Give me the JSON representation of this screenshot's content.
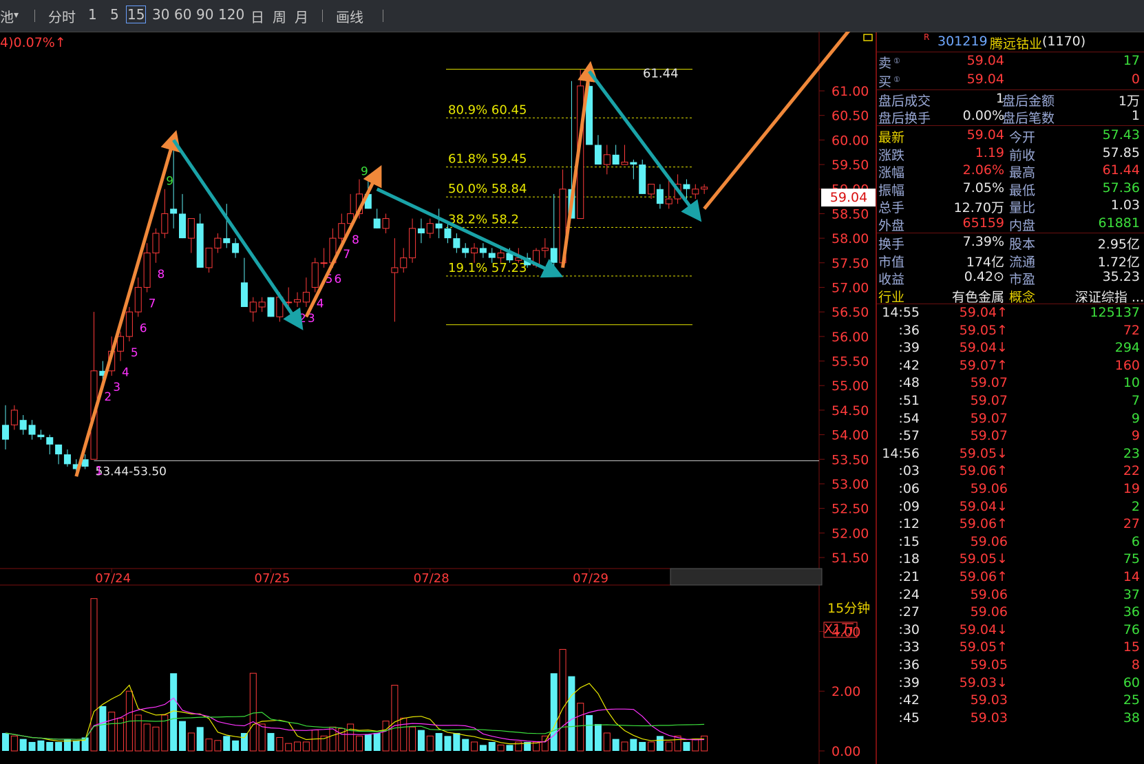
{
  "toolbar": {
    "left_fragment": "池",
    "periods": [
      "分时",
      "1",
      "5",
      "15",
      "30",
      "60",
      "90",
      "120",
      "日",
      "周",
      "月"
    ],
    "selected_period": "15",
    "draw_label": "画线"
  },
  "header": {
    "change_text": "4)0.07%↑"
  },
  "chart_data": [
    {
      "type": "candlestick",
      "price_ylim": [
        51.5,
        61.5
      ],
      "price_ticks": [
        "61.00",
        "60.50",
        "60.00",
        "59.50",
        "59.00",
        "58.50",
        "58.00",
        "57.50",
        "57.00",
        "56.50",
        "56.00",
        "55.50",
        "55.00",
        "54.50",
        "54.00",
        "53.50",
        "53.00",
        "52.50",
        "52.00",
        "51.50"
      ],
      "date_labels": [
        "07/24",
        "07/25",
        "07/28",
        "07/29"
      ],
      "period_label": "15分钟",
      "candles": [
        [
          54.2,
          54.6,
          53.7,
          53.9
        ],
        [
          54.2,
          54.6,
          54.1,
          54.5
        ],
        [
          54.3,
          54.4,
          54.0,
          54.1
        ],
        [
          54.2,
          54.3,
          53.9,
          54.0
        ],
        [
          54.0,
          54.1,
          53.9,
          53.95
        ],
        [
          53.95,
          54.0,
          53.6,
          53.8
        ],
        [
          53.8,
          53.8,
          53.4,
          53.6
        ],
        [
          53.6,
          53.7,
          53.35,
          53.4
        ],
        [
          53.4,
          53.5,
          53.2,
          53.3
        ],
        [
          53.5,
          53.6,
          53.3,
          53.35
        ],
        [
          53.5,
          56.5,
          53.5,
          55.3
        ],
        [
          55.3,
          55.5,
          55.0,
          55.2
        ],
        [
          55.3,
          56.0,
          55.2,
          55.7
        ],
        [
          55.7,
          56.1,
          55.5,
          56.0
        ],
        [
          56.0,
          56.6,
          55.9,
          56.5
        ],
        [
          56.5,
          57.2,
          56.4,
          57.0
        ],
        [
          57.0,
          57.9,
          56.9,
          57.7
        ],
        [
          57.7,
          58.2,
          57.5,
          58.1
        ],
        [
          58.1,
          59.0,
          58.0,
          58.5
        ],
        [
          58.6,
          60.1,
          58.2,
          58.5
        ],
        [
          58.5,
          58.9,
          58.0,
          58.0
        ],
        [
          58.0,
          58.4,
          57.7,
          58.4
        ],
        [
          58.3,
          58.5,
          57.4,
          57.4
        ],
        [
          57.4,
          57.8,
          57.3,
          57.8
        ],
        [
          57.8,
          58.1,
          57.7,
          58.0
        ],
        [
          58.0,
          58.7,
          57.8,
          57.9
        ],
        [
          57.9,
          58.0,
          57.6,
          57.7
        ],
        [
          57.1,
          57.6,
          56.9,
          56.6
        ],
        [
          56.5,
          56.8,
          56.3,
          56.7
        ],
        [
          56.6,
          56.8,
          56.5,
          56.7
        ],
        [
          56.8,
          56.8,
          56.4,
          56.4
        ],
        [
          56.4,
          56.9,
          56.3,
          56.8
        ],
        [
          56.7,
          57.0,
          56.6,
          56.7
        ],
        [
          56.7,
          56.9,
          56.6,
          56.75
        ],
        [
          56.7,
          57.2,
          56.6,
          56.9
        ],
        [
          57.0,
          57.6,
          56.9,
          57.5
        ],
        [
          57.5,
          57.8,
          57.4,
          57.5
        ],
        [
          57.5,
          58.2,
          57.4,
          58.0
        ],
        [
          58.0,
          58.5,
          57.9,
          58.3
        ],
        [
          58.3,
          58.9,
          58.2,
          58.5
        ],
        [
          58.5,
          59.2,
          58.4,
          58.9
        ],
        [
          58.9,
          59.2,
          58.6,
          58.6
        ],
        [
          58.4,
          58.6,
          58.2,
          58.2
        ],
        [
          58.2,
          58.5,
          58.1,
          58.4
        ],
        [
          57.3,
          58.0,
          56.3,
          57.4
        ],
        [
          57.4,
          57.8,
          57.3,
          57.6
        ],
        [
          57.6,
          58.4,
          57.5,
          58.2
        ],
        [
          58.2,
          58.4,
          57.9,
          58.1
        ],
        [
          58.1,
          58.4,
          58.0,
          58.3
        ],
        [
          58.3,
          58.6,
          58.0,
          58.2
        ],
        [
          58.2,
          58.3,
          57.9,
          58.0
        ],
        [
          58.0,
          58.1,
          57.7,
          57.8
        ],
        [
          57.8,
          57.9,
          57.6,
          57.7
        ],
        [
          57.7,
          57.9,
          57.5,
          57.8
        ],
        [
          57.8,
          57.9,
          57.6,
          57.7
        ],
        [
          57.7,
          57.8,
          57.5,
          57.6
        ],
        [
          57.6,
          57.8,
          57.5,
          57.7
        ],
        [
          57.7,
          57.8,
          57.5,
          57.55
        ],
        [
          57.55,
          57.8,
          57.5,
          57.6
        ],
        [
          57.6,
          57.7,
          57.4,
          57.45
        ],
        [
          57.45,
          57.8,
          57.4,
          57.75
        ],
        [
          57.75,
          58.0,
          57.6,
          57.8
        ],
        [
          57.8,
          58.9,
          57.4,
          57.5
        ],
        [
          57.5,
          59.4,
          57.5,
          59.0
        ],
        [
          59.0,
          61.2,
          58.4,
          58.4
        ],
        [
          58.4,
          61.44,
          58.4,
          61.1
        ],
        [
          61.1,
          61.2,
          59.9,
          59.9
        ],
        [
          59.9,
          60.1,
          59.5,
          59.5
        ],
        [
          59.5,
          59.9,
          59.3,
          59.7
        ],
        [
          59.7,
          59.9,
          59.5,
          59.5
        ],
        [
          59.5,
          59.9,
          59.5,
          59.55
        ],
        [
          59.55,
          59.6,
          59.2,
          59.5
        ],
        [
          59.5,
          59.6,
          58.9,
          58.9
        ],
        [
          58.9,
          59.1,
          58.8,
          59.1
        ],
        [
          59.0,
          59.1,
          58.6,
          58.7
        ],
        [
          58.7,
          59.2,
          58.6,
          58.8
        ],
        [
          58.8,
          59.3,
          58.7,
          59.1
        ],
        [
          59.1,
          59.2,
          58.8,
          59.0
        ],
        [
          58.9,
          59.1,
          58.8,
          59.0
        ],
        [
          59.0,
          59.1,
          58.9,
          59.04
        ]
      ],
      "sequence_labels": [
        {
          "i": 10,
          "text": "1"
        },
        {
          "i": 11,
          "text": "2"
        },
        {
          "i": 12,
          "text": "3"
        },
        {
          "i": 13,
          "text": "4"
        },
        {
          "i": 14,
          "text": "5"
        },
        {
          "i": 15,
          "text": "6"
        },
        {
          "i": 16,
          "text": "7"
        },
        {
          "i": 17,
          "text": "8"
        },
        {
          "i": 18,
          "text": "9",
          "green": true
        },
        {
          "i": 32,
          "text": "1"
        },
        {
          "i": 33,
          "text": "2"
        },
        {
          "i": 34,
          "text": "3"
        },
        {
          "i": 35,
          "text": "4"
        },
        {
          "i": 36,
          "text": "5"
        },
        {
          "i": 37,
          "text": "6"
        },
        {
          "i": 38,
          "text": "7"
        },
        {
          "i": 39,
          "text": "8"
        },
        {
          "i": 40,
          "text": "9",
          "green": true
        }
      ],
      "fib_levels": [
        {
          "label": "80.9% 60.45",
          "price": 60.45
        },
        {
          "label": "61.8% 59.45",
          "price": 59.45
        },
        {
          "label": "50.0% 58.84",
          "price": 58.84
        },
        {
          "label": "38.2% 58.2",
          "price": 58.22
        },
        {
          "label": "19.1% 57.23",
          "price": 57.23
        }
      ],
      "fib_range": [
        56.24,
        61.44
      ],
      "high_label": "61.44",
      "support_label": "53.44-53.50",
      "support_price": 53.47,
      "last_price": "59.04"
    },
    {
      "type": "bar",
      "name": "volume",
      "unit_label": "X1万",
      "ylim": [
        0,
        5.3
      ],
      "ticks": [
        "4.00",
        "2.00",
        "0.00"
      ],
      "values": [
        0.6,
        0.5,
        0.4,
        0.3,
        0.35,
        0.3,
        0.3,
        0.4,
        0.35,
        0.45,
        5.1,
        1.5,
        1.3,
        1.1,
        2.0,
        1.2,
        0.9,
        0.8,
        1.2,
        2.6,
        1.0,
        0.6,
        0.8,
        0.4,
        0.35,
        0.5,
        0.35,
        0.6,
        2.6,
        0.9,
        0.6,
        0.45,
        0.25,
        0.3,
        0.3,
        0.7,
        0.5,
        0.8,
        0.75,
        0.9,
        0.5,
        0.55,
        0.6,
        1.0,
        2.2,
        1.1,
        0.8,
        0.7,
        0.5,
        0.6,
        0.5,
        0.6,
        0.4,
        0.3,
        0.2,
        0.3,
        0.2,
        0.2,
        0.3,
        0.3,
        0.3,
        0.5,
        2.6,
        3.4,
        2.5,
        1.6,
        1.2,
        0.9,
        0.6,
        0.4,
        0.3,
        0.4,
        0.3,
        0.3,
        0.5,
        0.3,
        0.5,
        0.3,
        0.4,
        0.5
      ],
      "up_flags_from_price": true
    }
  ],
  "panel": {
    "rating": "R",
    "code": "301219",
    "name": "腾远钴业",
    "rank": "(1170)",
    "sell_label": "卖",
    "sell_price": "59.04",
    "sell_vol": "17",
    "buy_label": "买",
    "buy_price": "59.04",
    "buy_vol": "0",
    "after_hours": [
      {
        "l1": "盘后成交",
        "v1": "1",
        "l2": "盘后金额",
        "v2": "1万"
      },
      {
        "l1": "盘后换手",
        "v1": "0.00%",
        "l2": "盘后笔数",
        "v2": "1"
      }
    ],
    "quote": [
      {
        "l1": "最新",
        "v1": "59.04",
        "c1": "red",
        "l2": "今开",
        "v2": "57.43",
        "c2": "grn"
      },
      {
        "l1": "涨跌",
        "v1": "1.19",
        "c1": "red",
        "l2": "前收",
        "v2": "57.85",
        "c2": "wht"
      },
      {
        "l1": "涨幅",
        "v1": "2.06%",
        "c1": "red",
        "l2": "最高",
        "v2": "61.44",
        "c2": "red"
      },
      {
        "l1": "振幅",
        "v1": "7.05%",
        "c1": "wht",
        "l2": "最低",
        "v2": "57.36",
        "c2": "grn"
      },
      {
        "l1": "总手",
        "v1": "12.70万",
        "c1": "wht",
        "l2": "量比",
        "v2": "1.03",
        "c2": "wht"
      },
      {
        "l1": "外盘",
        "v1": "65159",
        "c1": "red",
        "l2": "内盘",
        "v2": "61881",
        "c2": "grn"
      }
    ],
    "fundamentals": [
      {
        "l1": "换手",
        "v1": "7.39%",
        "l2": "股本",
        "v2": "2.95亿"
      },
      {
        "l1": "市值",
        "v1": "174亿",
        "l2": "流通",
        "v2": "1.72亿"
      },
      {
        "l1": "收益",
        "v1": "0.42⊙",
        "l2": "市盈",
        "v2": "35.23"
      }
    ],
    "industry_label": "行业",
    "industry_value": "有色金属",
    "concept_label": "概念",
    "concept_value": "深证综指 ..."
  },
  "ticks": [
    {
      "t": "14:55",
      "p": "59.04↑",
      "v": "125137",
      "pc": "red",
      "vc": "grn"
    },
    {
      "t": ":36",
      "p": "59.05↑",
      "v": "72",
      "pc": "red",
      "vc": "red"
    },
    {
      "t": ":39",
      "p": "59.04↓",
      "v": "294",
      "pc": "red",
      "vc": "grn"
    },
    {
      "t": ":42",
      "p": "59.07↑",
      "v": "160",
      "pc": "red",
      "vc": "red"
    },
    {
      "t": ":48",
      "p": "59.07",
      "v": "10",
      "pc": "red",
      "vc": "grn"
    },
    {
      "t": ":51",
      "p": "59.07",
      "v": "7",
      "pc": "red",
      "vc": "grn"
    },
    {
      "t": ":54",
      "p": "59.07",
      "v": "9",
      "pc": "red",
      "vc": "grn"
    },
    {
      "t": ":57",
      "p": "59.07",
      "v": "9",
      "pc": "red",
      "vc": "red"
    },
    {
      "t": "14:56",
      "p": "59.05↓",
      "v": "23",
      "pc": "red",
      "vc": "grn"
    },
    {
      "t": ":03",
      "p": "59.06↑",
      "v": "22",
      "pc": "red",
      "vc": "red"
    },
    {
      "t": ":06",
      "p": "59.06",
      "v": "19",
      "pc": "red",
      "vc": "red"
    },
    {
      "t": ":09",
      "p": "59.04↓",
      "v": "2",
      "pc": "red",
      "vc": "grn"
    },
    {
      "t": ":12",
      "p": "59.06↑",
      "v": "27",
      "pc": "red",
      "vc": "red"
    },
    {
      "t": ":15",
      "p": "59.06",
      "v": "6",
      "pc": "red",
      "vc": "grn"
    },
    {
      "t": ":18",
      "p": "59.05↓",
      "v": "75",
      "pc": "red",
      "vc": "grn"
    },
    {
      "t": ":21",
      "p": "59.06↑",
      "v": "14",
      "pc": "red",
      "vc": "red"
    },
    {
      "t": ":24",
      "p": "59.06",
      "v": "37",
      "pc": "red",
      "vc": "grn"
    },
    {
      "t": ":27",
      "p": "59.06",
      "v": "36",
      "pc": "red",
      "vc": "grn"
    },
    {
      "t": ":30",
      "p": "59.04↓",
      "v": "76",
      "pc": "red",
      "vc": "grn"
    },
    {
      "t": ":33",
      "p": "59.05↑",
      "v": "15",
      "pc": "red",
      "vc": "red"
    },
    {
      "t": ":36",
      "p": "59.05",
      "v": "8",
      "pc": "red",
      "vc": "red"
    },
    {
      "t": ":39",
      "p": "59.03↓",
      "v": "60",
      "pc": "red",
      "vc": "grn"
    },
    {
      "t": ":42",
      "p": "59.03",
      "v": "25",
      "pc": "red",
      "vc": "grn"
    },
    {
      "t": ":45",
      "p": "59.03",
      "v": "38",
      "pc": "red",
      "vc": "grn"
    }
  ],
  "colors": {
    "up": "#ff3b3b",
    "down": "#5ff0f5",
    "fib": "#e8e800",
    "arrow_up": "#f0883a",
    "arrow_down": "#1aa3a8",
    "grid": "#7a1010"
  }
}
